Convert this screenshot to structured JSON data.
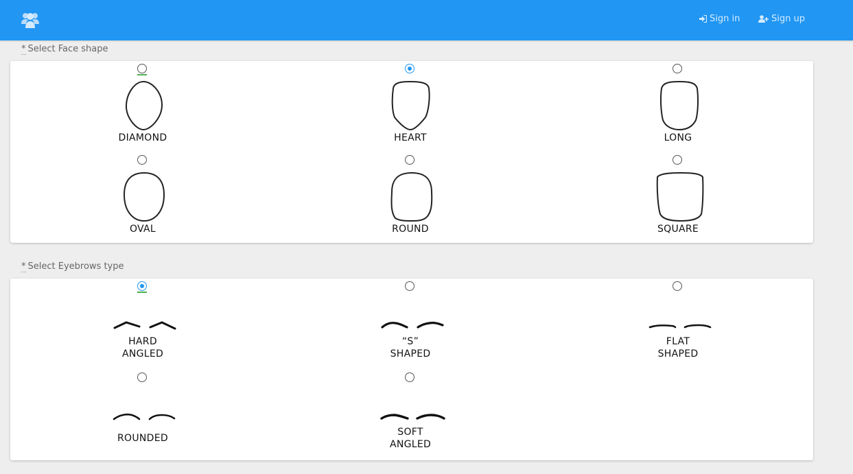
{
  "navbar": {
    "brand_icon": "users-icon",
    "signin_label": "Sign in",
    "signin_icon": "sign-in-icon",
    "signup_label": "Sign up",
    "signup_icon": "user-plus-icon",
    "color": "#2196f3"
  },
  "face": {
    "required_mark": "*",
    "label": "Select Face shape",
    "options": [
      {
        "label": "DIAMOND",
        "checked": false
      },
      {
        "label": "HEART",
        "checked": true
      },
      {
        "label": "LONG",
        "checked": false
      },
      {
        "label": "OVAL",
        "checked": false
      },
      {
        "label": "ROUND",
        "checked": false
      },
      {
        "label": "SQUARE",
        "checked": false
      }
    ]
  },
  "eyebrows": {
    "required_mark": "*",
    "label": "Select Eyebrows type",
    "options": [
      {
        "line1": "HARD",
        "line2": "ANGLED",
        "checked": true
      },
      {
        "line1": "“S”",
        "line2": "SHAPED",
        "checked": false
      },
      {
        "line1": "FLAT",
        "line2": "SHAPED",
        "checked": false
      },
      {
        "line1": "ROUNDED",
        "line2": "",
        "checked": false
      },
      {
        "line1": "SOFT",
        "line2": "ANGLED",
        "checked": false
      }
    ]
  }
}
